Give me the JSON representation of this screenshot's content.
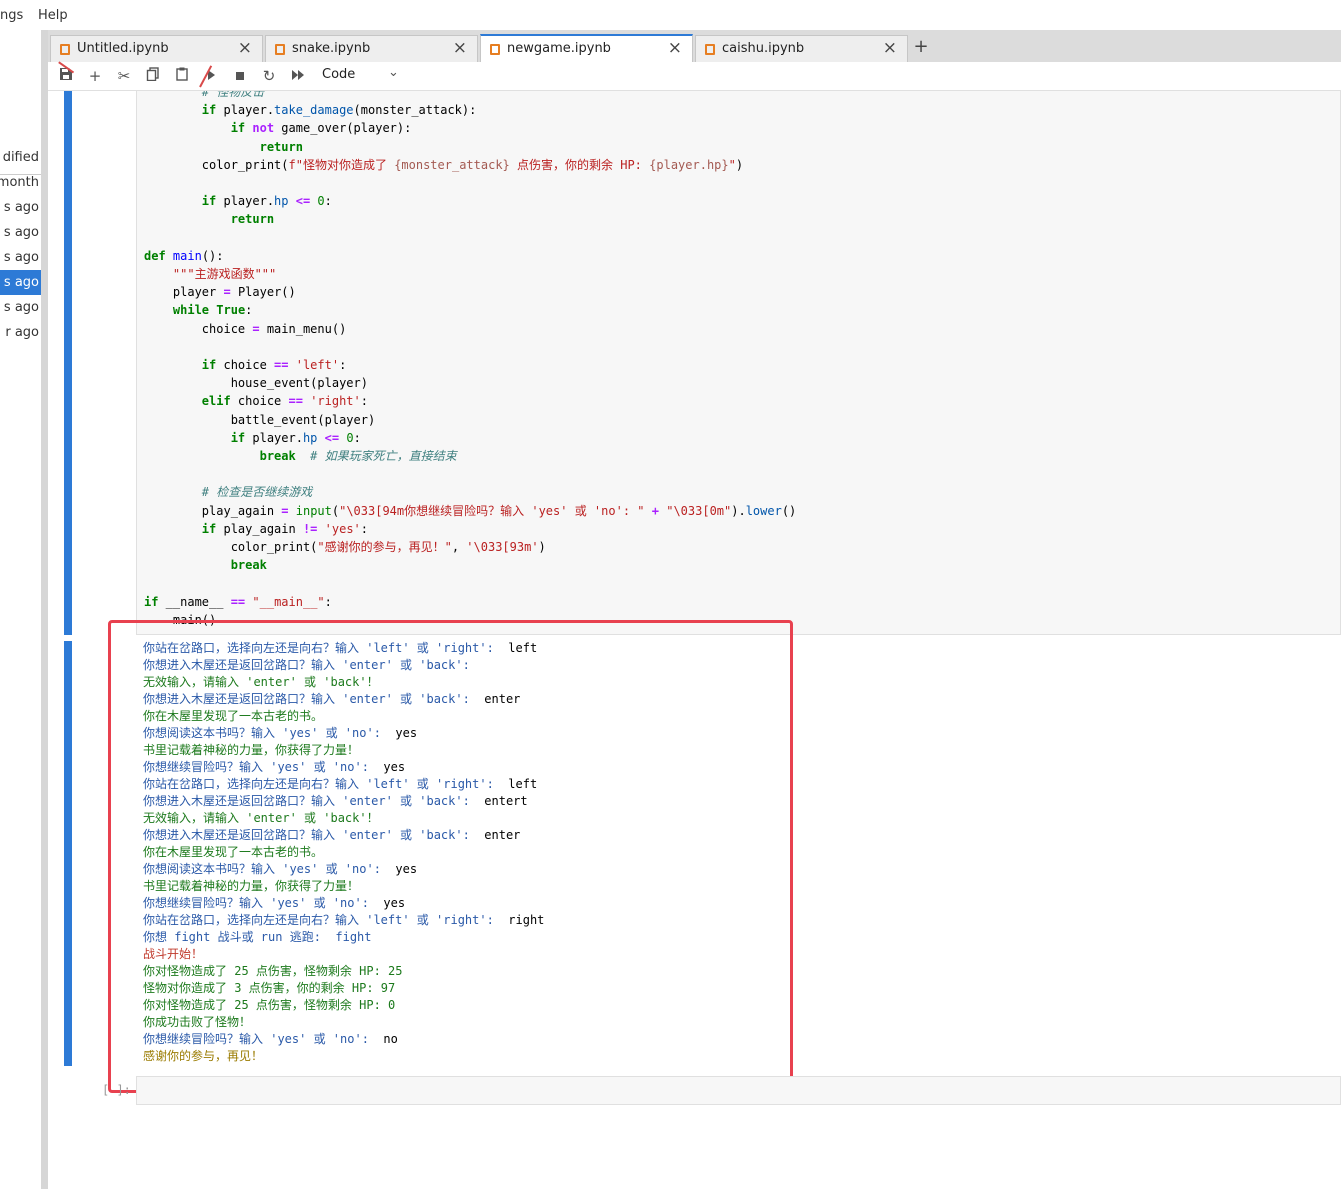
{
  "menubar": {
    "items": [
      "ngs",
      "Help"
    ]
  },
  "file_browser": {
    "header": "dified",
    "items": [
      "month",
      "s ago",
      "s ago",
      "s ago",
      "s ago",
      "s ago",
      "r ago"
    ],
    "selected_index": 4
  },
  "tabs": [
    {
      "label": "Untitled.ipynb",
      "active": false
    },
    {
      "label": "snake.ipynb",
      "active": false
    },
    {
      "label": "newgame.ipynb",
      "active": true
    },
    {
      "label": "caishu.ipynb",
      "active": false
    }
  ],
  "toolbar": {
    "cell_type": "Code"
  },
  "code_lines": [
    [
      [
        "cm",
        "        # 怪物反击"
      ]
    ],
    [
      [
        "t",
        "        "
      ],
      [
        "kw",
        "if"
      ],
      [
        "t",
        " player."
      ],
      [
        "at",
        "take_damage"
      ],
      [
        "t",
        "(monster_attack):"
      ]
    ],
    [
      [
        "t",
        "            "
      ],
      [
        "kw",
        "if"
      ],
      [
        "t",
        " "
      ],
      [
        "op",
        "not"
      ],
      [
        "t",
        " game_over(player):"
      ]
    ],
    [
      [
        "t",
        "                "
      ],
      [
        "kw",
        "return"
      ]
    ],
    [
      [
        "t",
        "        color_print("
      ],
      [
        "st",
        "f\"怪物对你造成了 "
      ],
      [
        "sp",
        "{monster_attack}"
      ],
      [
        "st",
        " 点伤害，你的剩余 HP: "
      ],
      [
        "sp",
        "{player.hp}"
      ],
      [
        "st",
        "\""
      ],
      [
        "t",
        ")"
      ]
    ],
    [
      [
        "t",
        ""
      ]
    ],
    [
      [
        "t",
        "        "
      ],
      [
        "kw",
        "if"
      ],
      [
        "t",
        " player."
      ],
      [
        "at",
        "hp"
      ],
      [
        "t",
        " "
      ],
      [
        "op",
        "<="
      ],
      [
        "t",
        " "
      ],
      [
        "nm",
        "0"
      ],
      [
        "t",
        ":"
      ]
    ],
    [
      [
        "t",
        "            "
      ],
      [
        "kw",
        "return"
      ]
    ],
    [
      [
        "t",
        ""
      ]
    ],
    [
      [
        "kw",
        "def"
      ],
      [
        "t",
        " "
      ],
      [
        "fn",
        "main"
      ],
      [
        "t",
        "():"
      ]
    ],
    [
      [
        "t",
        "    "
      ],
      [
        "st",
        "\"\"\"主游戏函数\"\"\""
      ]
    ],
    [
      [
        "t",
        "    player "
      ],
      [
        "op",
        "="
      ],
      [
        "t",
        " Player()"
      ]
    ],
    [
      [
        "t",
        "    "
      ],
      [
        "kw",
        "while"
      ],
      [
        "t",
        " "
      ],
      [
        "kw",
        "True"
      ],
      [
        "t",
        ":"
      ]
    ],
    [
      [
        "t",
        "        choice "
      ],
      [
        "op",
        "="
      ],
      [
        "t",
        " main_menu()"
      ]
    ],
    [
      [
        "t",
        ""
      ]
    ],
    [
      [
        "t",
        "        "
      ],
      [
        "kw",
        "if"
      ],
      [
        "t",
        " choice "
      ],
      [
        "op",
        "=="
      ],
      [
        "t",
        " "
      ],
      [
        "st",
        "'left'"
      ],
      [
        "t",
        ":"
      ]
    ],
    [
      [
        "t",
        "            house_event(player)"
      ]
    ],
    [
      [
        "t",
        "        "
      ],
      [
        "kw",
        "elif"
      ],
      [
        "t",
        " choice "
      ],
      [
        "op",
        "=="
      ],
      [
        "t",
        " "
      ],
      [
        "st",
        "'right'"
      ],
      [
        "t",
        ":"
      ]
    ],
    [
      [
        "t",
        "            battle_event(player)"
      ]
    ],
    [
      [
        "t",
        "            "
      ],
      [
        "kw",
        "if"
      ],
      [
        "t",
        " player."
      ],
      [
        "at",
        "hp"
      ],
      [
        "t",
        " "
      ],
      [
        "op",
        "<="
      ],
      [
        "t",
        " "
      ],
      [
        "nm",
        "0"
      ],
      [
        "t",
        ":"
      ]
    ],
    [
      [
        "t",
        "                "
      ],
      [
        "kw",
        "break"
      ],
      [
        "t",
        "  "
      ],
      [
        "cm",
        "# 如果玩家死亡，直接结束"
      ]
    ],
    [
      [
        "t",
        ""
      ]
    ],
    [
      [
        "t",
        "        "
      ],
      [
        "cm",
        "# 检查是否继续游戏"
      ]
    ],
    [
      [
        "t",
        "        play_again "
      ],
      [
        "op",
        "="
      ],
      [
        "t",
        " "
      ],
      [
        "bi",
        "input"
      ],
      [
        "t",
        "("
      ],
      [
        "st",
        "\"\\033[94m你想继续冒险吗？输入 'yes' 或 'no': \""
      ],
      [
        "t",
        " "
      ],
      [
        "op",
        "+"
      ],
      [
        "t",
        " "
      ],
      [
        "st",
        "\"\\033[0m\""
      ],
      [
        "t",
        ")."
      ],
      [
        "at",
        "lower"
      ],
      [
        "t",
        "()"
      ]
    ],
    [
      [
        "t",
        "        "
      ],
      [
        "kw",
        "if"
      ],
      [
        "t",
        " play_again "
      ],
      [
        "op",
        "!="
      ],
      [
        "t",
        " "
      ],
      [
        "st",
        "'yes'"
      ],
      [
        "t",
        ":"
      ]
    ],
    [
      [
        "t",
        "            color_print("
      ],
      [
        "st",
        "\"感谢你的参与，再见！\""
      ],
      [
        "t",
        ", "
      ],
      [
        "st",
        "'\\033[93m'"
      ],
      [
        "t",
        ")"
      ]
    ],
    [
      [
        "t",
        "            "
      ],
      [
        "kw",
        "break"
      ]
    ],
    [
      [
        "t",
        ""
      ]
    ],
    [
      [
        "kw",
        "if"
      ],
      [
        "t",
        " __name__ "
      ],
      [
        "op",
        "=="
      ],
      [
        "t",
        " "
      ],
      [
        "st",
        "\"__main__\""
      ],
      [
        "t",
        ":"
      ]
    ],
    [
      [
        "t",
        "    main()"
      ]
    ]
  ],
  "output_lines": [
    [
      [
        "o-blue",
        "你站在岔路口，选择向左还是向右？输入 'left' 或 'right': "
      ],
      [
        "o-black",
        " left"
      ]
    ],
    [
      [
        "o-blue",
        "你想进入木屋还是返回岔路口？输入 'enter' 或 'back': "
      ],
      [
        "o-black",
        ""
      ]
    ],
    [
      [
        "o-green",
        "无效输入，请输入 'enter' 或 'back'！"
      ]
    ],
    [
      [
        "o-blue",
        "你想进入木屋还是返回岔路口？输入 'enter' 或 'back': "
      ],
      [
        "o-black",
        " enter"
      ]
    ],
    [
      [
        "o-green",
        "你在木屋里发现了一本古老的书。"
      ]
    ],
    [
      [
        "o-blue",
        "你想阅读这本书吗？输入 'yes' 或 'no': "
      ],
      [
        "o-black",
        " yes"
      ]
    ],
    [
      [
        "o-green",
        "书里记载着神秘的力量，你获得了力量！"
      ]
    ],
    [
      [
        "o-blue",
        "你想继续冒险吗？输入 'yes' 或 'no': "
      ],
      [
        "o-black",
        " yes"
      ]
    ],
    [
      [
        "o-blue",
        "你站在岔路口，选择向左还是向右？输入 'left' 或 'right': "
      ],
      [
        "o-black",
        " left"
      ]
    ],
    [
      [
        "o-blue",
        "你想进入木屋还是返回岔路口？输入 'enter' 或 'back': "
      ],
      [
        "o-black",
        " entert"
      ]
    ],
    [
      [
        "o-green",
        "无效输入，请输入 'enter' 或 'back'！"
      ]
    ],
    [
      [
        "o-blue",
        "你想进入木屋还是返回岔路口？输入 'enter' 或 'back': "
      ],
      [
        "o-black",
        " enter"
      ]
    ],
    [
      [
        "o-green",
        "你在木屋里发现了一本古老的书。"
      ]
    ],
    [
      [
        "o-blue",
        "你想阅读这本书吗？输入 'yes' 或 'no': "
      ],
      [
        "o-black",
        " yes"
      ]
    ],
    [
      [
        "o-green",
        "书里记载着神秘的力量，你获得了力量！"
      ]
    ],
    [
      [
        "o-blue",
        "你想继续冒险吗？输入 'yes' 或 'no': "
      ],
      [
        "o-black",
        " yes"
      ]
    ],
    [
      [
        "o-blue",
        "你站在岔路口，选择向左还是向右？输入 'left' 或 'right': "
      ],
      [
        "o-black",
        " right"
      ]
    ],
    [
      [
        "o-blue",
        "你想 fight 战斗或 run 逃跑: "
      ],
      [
        "o-blue",
        " fight"
      ]
    ],
    [
      [
        "o-red",
        "战斗开始！"
      ]
    ],
    [
      [
        "o-green",
        "你对怪物造成了 25 点伤害，怪物剩余 HP: 25"
      ]
    ],
    [
      [
        "o-green",
        "怪物对你造成了 3 点伤害，你的剩余 HP: 97"
      ]
    ],
    [
      [
        "o-green",
        "你对怪物造成了 25 点伤害，怪物剩余 HP: 0"
      ]
    ],
    [
      [
        "o-green",
        "你成功击败了怪物！"
      ]
    ],
    [
      [
        "o-blue",
        "你想继续冒险吗？输入 'yes' 或 'no': "
      ],
      [
        "o-black",
        " no"
      ]
    ],
    [
      [
        "o-yellow",
        "感谢你的参与，再见！"
      ]
    ]
  ],
  "empty_cell_prompt": "[ ]:"
}
